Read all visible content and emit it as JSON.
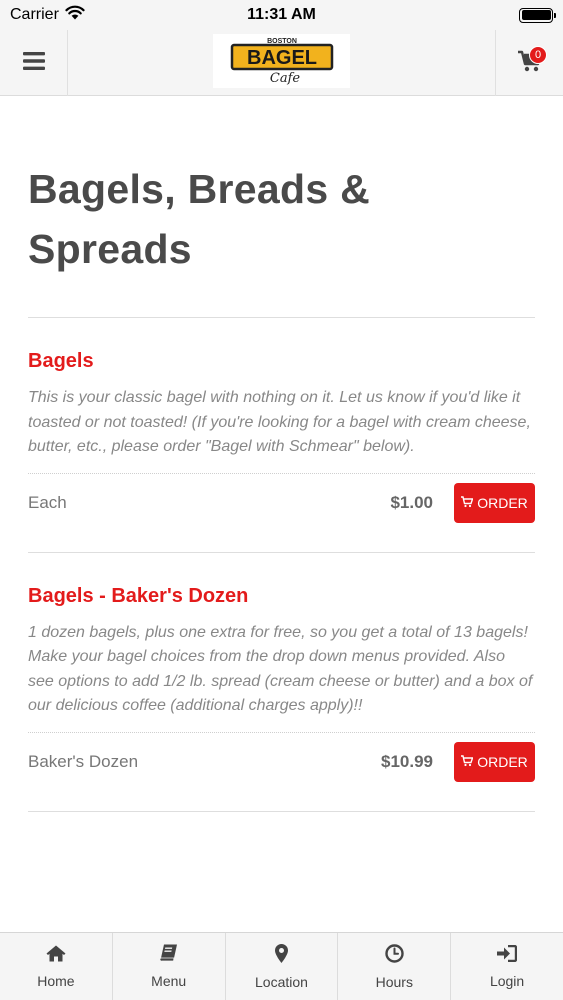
{
  "status_bar": {
    "carrier": "Carrier",
    "time": "11:31 AM"
  },
  "header": {
    "logo": {
      "top_text": "BOSTON",
      "main_text": "BAGEL",
      "script_text": "Cafe"
    },
    "cart_count": "0"
  },
  "page_title": "Bagels, Breads & Spreads",
  "items": [
    {
      "name": "Bagels",
      "description": "This is your classic bagel with nothing on it. Let us know if you'd like it toasted or not toasted! (If you're looking for a bagel with cream cheese, butter, etc., please order \"Bagel with Schmear\" below).",
      "size": "Each",
      "price": "$1.00",
      "order_label": "ORDER"
    },
    {
      "name": "Bagels - Baker's Dozen",
      "description": "1 dozen bagels, plus one extra for free, so you get a total of 13 bagels! Make your bagel choices from the drop down menus provided. Also see options to add 1/2 lb. spread (cream cheese or butter) and a box of our delicious coffee (additional charges apply)!!",
      "size": "Baker's Dozen",
      "price": "$10.99",
      "order_label": "ORDER"
    }
  ],
  "bottom_nav": [
    {
      "label": "Home",
      "icon": "home-icon"
    },
    {
      "label": "Menu",
      "icon": "book-icon"
    },
    {
      "label": "Location",
      "icon": "map-pin-icon"
    },
    {
      "label": "Hours",
      "icon": "clock-icon"
    },
    {
      "label": "Login",
      "icon": "sign-in-icon"
    }
  ],
  "colors": {
    "accent": "#e31b1b",
    "header_bg": "#f5f5f5",
    "title": "#4a4a4a",
    "logo_yellow": "#f2b21d"
  }
}
